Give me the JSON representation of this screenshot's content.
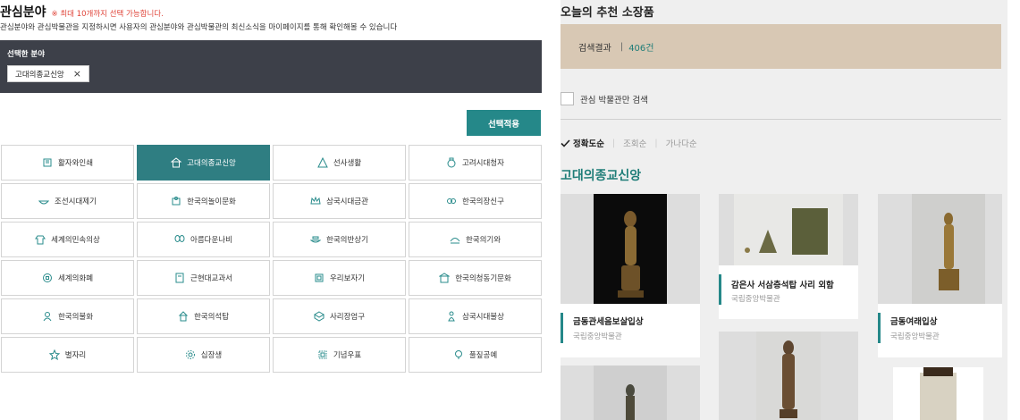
{
  "left": {
    "title": "관심분야",
    "note": "※ 최대 10개까지 선택 가능합니다.",
    "description": "관심분야와 관심박물관을 지정하시면 사용자의 관심분야와 관심박물관의 최신소식을 마이페이지를 통해 확인해볼 수 있습니다",
    "selected_label": "선택한 분야",
    "selected_chip": "고대의종교신앙",
    "chip_close": "×",
    "apply_button": "선택적용",
    "categories": [
      {
        "label": "활자와인쇄",
        "icon": "book-icon",
        "active": false
      },
      {
        "label": "고대의종교신앙",
        "icon": "temple-icon",
        "active": true
      },
      {
        "label": "선사생활",
        "icon": "hut-icon",
        "active": false
      },
      {
        "label": "고려시대청자",
        "icon": "vase-icon",
        "active": false
      },
      {
        "label": "조선시대제기",
        "icon": "bowl-icon",
        "active": false
      },
      {
        "label": "한국의놀이문화",
        "icon": "puzzle-icon",
        "active": false
      },
      {
        "label": "삼국시대금관",
        "icon": "crown-icon",
        "active": false
      },
      {
        "label": "한국의장신구",
        "icon": "ornament-icon",
        "active": false
      },
      {
        "label": "세계의민속의상",
        "icon": "clothes-icon",
        "active": false
      },
      {
        "label": "아름다운나비",
        "icon": "butterfly-icon",
        "active": false
      },
      {
        "label": "한국의반상기",
        "icon": "tableware-icon",
        "active": false
      },
      {
        "label": "한국의기와",
        "icon": "roof-tile-icon",
        "active": false
      },
      {
        "label": "세계의화폐",
        "icon": "coin-icon",
        "active": false
      },
      {
        "label": "근현대교과서",
        "icon": "textbook-icon",
        "active": false
      },
      {
        "label": "우리보자기",
        "icon": "wrapping-cloth-icon",
        "active": false
      },
      {
        "label": "한국의청동기문화",
        "icon": "bronze-icon",
        "active": false
      },
      {
        "label": "한국의불화",
        "icon": "buddha-painting-icon",
        "active": false
      },
      {
        "label": "한국의석탑",
        "icon": "pagoda-icon",
        "active": false
      },
      {
        "label": "사리장엄구",
        "icon": "reliquary-icon",
        "active": false
      },
      {
        "label": "삼국시대불상",
        "icon": "buddha-statue-icon",
        "active": false
      },
      {
        "label": "별자리",
        "icon": "star-icon",
        "active": false
      },
      {
        "label": "십장생",
        "icon": "longevity-icon",
        "active": false
      },
      {
        "label": "기념우표",
        "icon": "stamp-icon",
        "active": false
      },
      {
        "label": "풀짚공예",
        "icon": "straw-craft-icon",
        "active": false
      }
    ]
  },
  "right": {
    "title": "오늘의 추천 소장품",
    "search_result_label": "검색결과",
    "search_result_count": "406건",
    "checkbox_label": "관심 박물관만 검색",
    "sort_options": [
      {
        "label": "정확도순",
        "active": true
      },
      {
        "label": "조회순",
        "active": false
      },
      {
        "label": "가나다순",
        "active": false
      }
    ],
    "category_heading": "고대의종교신앙",
    "cards": [
      {
        "name": "금동관세음보살입상",
        "museum": "국립중앙박물관"
      },
      {
        "name": "감은사 서삼층석탑 사리 외함",
        "museum": "국립중앙박물관"
      },
      {
        "name": "금동여래입상",
        "museum": "국립중앙박물관"
      }
    ]
  },
  "colors": {
    "accent": "#258889",
    "dark_panel": "#3d4049",
    "banner": "#d8c8b4",
    "note_red": "#e0463b"
  }
}
